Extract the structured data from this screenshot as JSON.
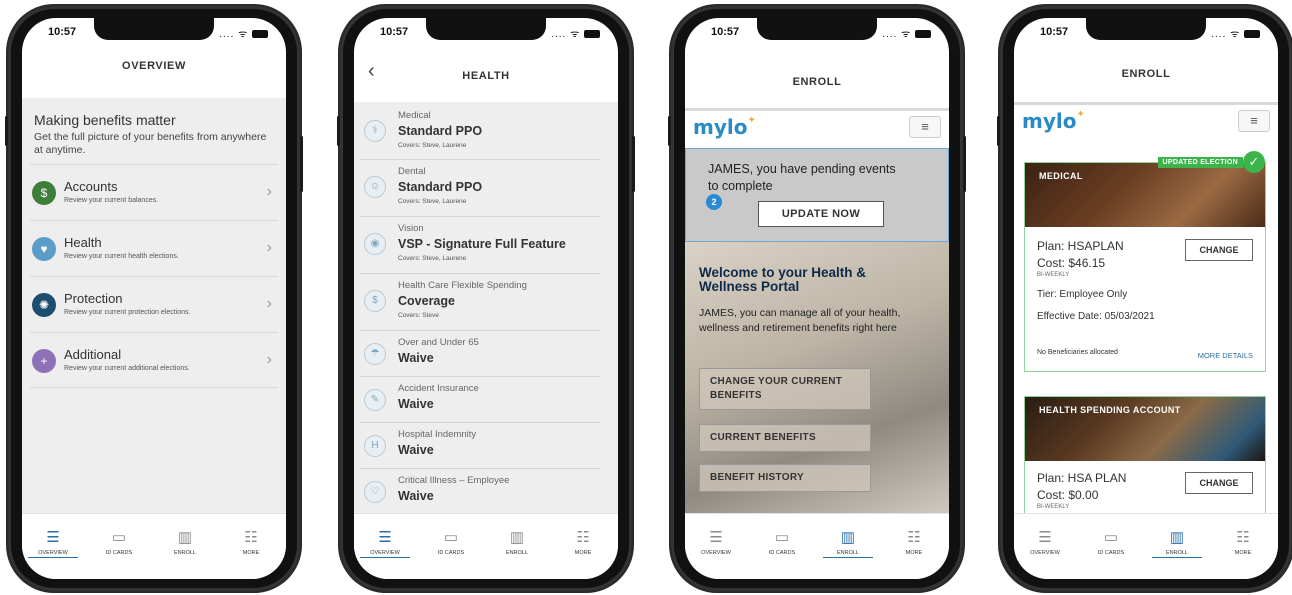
{
  "status": {
    "time": "10:57"
  },
  "tabs": [
    "OVERVIEW",
    "ID CARDS",
    "ENROLL",
    "MORE"
  ],
  "screen1": {
    "title": "OVERVIEW",
    "hero_title": "Making benefits matter",
    "hero_sub": "Get the full picture of your benefits from anywhere at anytime.",
    "rows": [
      {
        "title": "Accounts",
        "sub": "Review your current balances.",
        "color": "#3f7d3a",
        "icon": "$"
      },
      {
        "title": "Health",
        "sub": "Review your current health elections.",
        "color": "#5b9cc8",
        "icon": "♥"
      },
      {
        "title": "Protection",
        "sub": "Review your current protection elections.",
        "color": "#1e4e6e",
        "icon": "✺"
      },
      {
        "title": "Additional",
        "sub": "Review your current additional elections.",
        "color": "#8e72b8",
        "icon": "+"
      }
    ]
  },
  "screen2": {
    "title": "HEALTH",
    "back": "‹",
    "rows": [
      {
        "cat": "Medical",
        "plan": "Standard PPO",
        "cov": "Covers: Steve, Laurene",
        "icon": "⚕"
      },
      {
        "cat": "Dental",
        "plan": "Standard PPO",
        "cov": "Covers: Steve, Laurene",
        "icon": "☺"
      },
      {
        "cat": "Vision",
        "plan": "VSP - Signature Full Feature",
        "cov": "Covers: Steve, Laurene",
        "icon": "◉"
      },
      {
        "cat": "Health Care Flexible Spending",
        "plan": "Coverage",
        "cov": "Covers: Steve",
        "icon": "$"
      },
      {
        "cat": "Over and Under 65",
        "plan": "Waive",
        "cov": "",
        "icon": "☂"
      },
      {
        "cat": "Accident Insurance",
        "plan": "Waive",
        "cov": "",
        "icon": "✎"
      },
      {
        "cat": "Hospital Indemnity",
        "plan": "Waive",
        "cov": "",
        "icon": "H"
      },
      {
        "cat": "Critical Illness – Employee",
        "plan": "Waive",
        "cov": "",
        "icon": "♡"
      }
    ]
  },
  "screen3": {
    "title": "ENROLL",
    "logo": "mylo",
    "pending_msg": "JAMES, you have pending events to complete",
    "badge": "2",
    "update_btn": "UPDATE NOW",
    "welcome": "Welcome to your Health & Wellness Portal",
    "welcome_text": "JAMES, you can manage all of your health, wellness and retirement benefits right here",
    "buttons": [
      "CHANGE YOUR CURRENT BENEFITS",
      "CURRENT BENEFITS",
      "BENEFIT HISTORY"
    ]
  },
  "screen4": {
    "title": "ENROLL",
    "logo": "mylo",
    "card1": {
      "label": "MEDICAL",
      "tag": "UPDATED ELECTION",
      "plan": "Plan: HSAPLAN",
      "cost": "Cost: $46.15",
      "freq": "BI-WEEKLY",
      "tier": "Tier: Employee Only",
      "effective": "Effective Date: 05/03/2021",
      "beneficiaries": "No Beneficiaries allocated",
      "more": "MORE DETAILS",
      "change": "CHANGE"
    },
    "card2": {
      "label": "HEALTH SPENDING ACCOUNT",
      "plan": "Plan: HSA PLAN",
      "cost": "Cost: $0.00",
      "freq": "BI-WEEKLY",
      "change": "CHANGE"
    }
  }
}
